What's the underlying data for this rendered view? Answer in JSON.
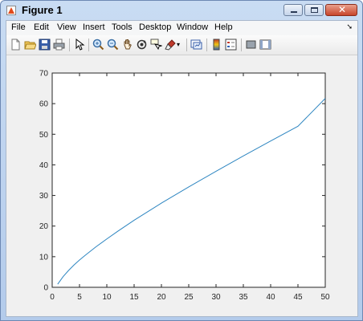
{
  "window": {
    "title": "Figure 1"
  },
  "menu": {
    "items": [
      {
        "label": "File"
      },
      {
        "label": "Edit"
      },
      {
        "label": "View"
      },
      {
        "label": "Insert"
      },
      {
        "label": "Tools"
      },
      {
        "label": "Desktop"
      },
      {
        "label": "Window"
      },
      {
        "label": "Help"
      }
    ]
  },
  "toolbar": {
    "icons": [
      "new-figure-icon",
      "open-file-icon",
      "save-icon",
      "print-icon",
      "pointer-icon",
      "zoom-in-icon",
      "zoom-out-icon",
      "pan-hand-icon",
      "rotate-3d-icon",
      "data-cursor-icon",
      "brush-icon",
      "brush-dropdown-icon",
      "link-plot-icon",
      "colorbar-icon",
      "legend-icon",
      "hide-plot-tools-icon",
      "show-plot-tools-icon"
    ]
  },
  "chart_data": {
    "type": "line",
    "title": "",
    "xlabel": "",
    "ylabel": "",
    "xlim": [
      0,
      50
    ],
    "ylim": [
      0,
      70
    ],
    "xticks": [
      "0",
      "5",
      "10",
      "15",
      "20",
      "25",
      "30",
      "35",
      "40",
      "45",
      "50"
    ],
    "yticks": [
      "0",
      "10",
      "20",
      "30",
      "40",
      "50",
      "60",
      "70"
    ],
    "grid": false,
    "series": [
      {
        "color": "#2e86c1",
        "x": [
          1,
          2,
          3,
          4,
          5,
          6,
          8,
          10,
          12,
          15,
          20,
          25,
          30,
          35,
          40,
          45,
          50
        ],
        "y": [
          1.0,
          3.5,
          5.5,
          7.3,
          8.9,
          10.4,
          13.2,
          15.8,
          18.3,
          21.9,
          27.5,
          32.8,
          37.9,
          42.9,
          47.8,
          52.6,
          61.7
        ]
      }
    ]
  }
}
